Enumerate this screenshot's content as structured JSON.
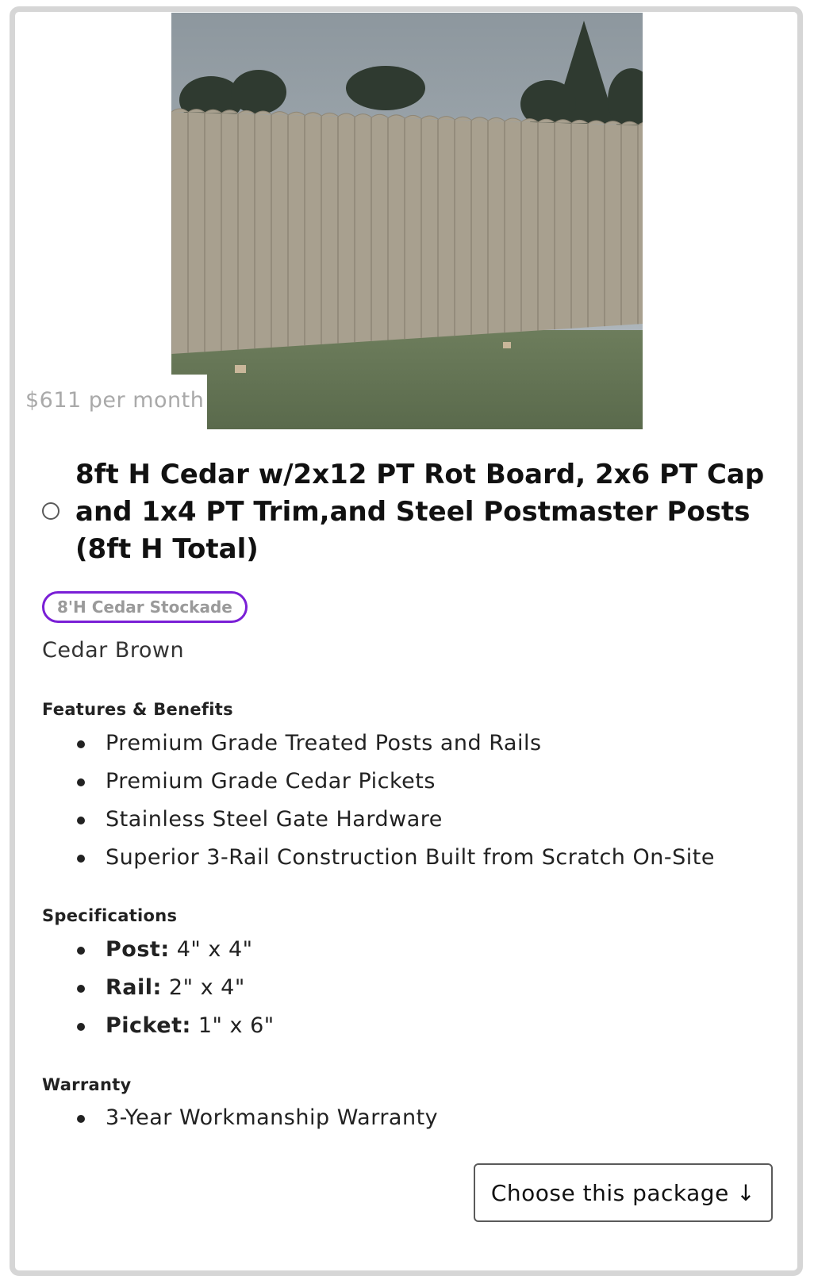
{
  "product": {
    "image_alt": "Fence photo",
    "price": "$611 per month",
    "title": "8ft H Cedar w/2x12 PT Rot Board, 2x6 PT Cap and 1x4 PT Trim,and Steel Postmaster Posts (8ft H Total)",
    "badge": "8'H Cedar Stockade",
    "color": "Cedar Brown",
    "accent_color": "#7a1fd6"
  },
  "features": {
    "heading": "Features & Benefits",
    "items": [
      "Premium Grade Treated Posts and Rails",
      "Premium Grade Cedar Pickets",
      "Stainless Steel Gate Hardware",
      "Superior 3-Rail Construction Built from Scratch On-Site"
    ]
  },
  "specifications": {
    "heading": "Specifications",
    "items": [
      {
        "key": "Post:",
        "value": " 4\" x 4\""
      },
      {
        "key": "Rail:",
        "value": " 2\" x 4\""
      },
      {
        "key": "Picket:",
        "value": " 1\" x 6\""
      }
    ]
  },
  "warranty": {
    "heading": "Warranty",
    "items": [
      "3-Year Workmanship Warranty"
    ]
  },
  "cta": {
    "label": "Choose this package ↓"
  }
}
